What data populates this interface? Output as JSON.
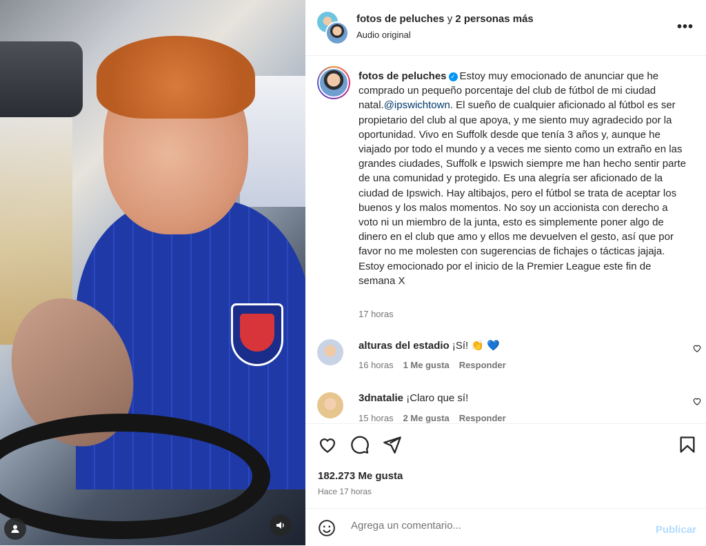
{
  "media": {
    "user_icon": "person-icon",
    "audio_icon": "speaker-icon"
  },
  "header": {
    "title_user": "fotos de peluches",
    "title_rest": " y ",
    "title_others": "2 personas más",
    "subtitle": "Audio original",
    "more_icon": "more-horizontal-icon",
    "more_label": "•••"
  },
  "caption": {
    "username": "fotos de peluches",
    "verified_icon": "verified-badge-icon",
    "verified_glyph": "✓",
    "text_part1": "Estoy muy emocionado de anunciar que he comprado un pequeño porcentaje del club de fútbol de mi ciudad natal.",
    "mention": "@ipswichtown",
    "text_part2": ". El sueño de cualquier aficionado al fútbol es ser propietario del club al que apoya, y me siento muy agradecido por la oportunidad. Vivo en Suffolk desde que tenía 3 años y, aunque he viajado por todo el mundo y a veces me siento como un extraño en las grandes ciudades, Suffolk e Ipswich siempre me han hecho sentir parte de una comunidad y protegido. Es una alegría ser aficionado de la ciudad de Ipswich. Hay altibajos, pero el fútbol se trata de aceptar los buenos y los malos momentos. No soy un accionista con derecho a voto ni un miembro de la junta, esto es simplemente poner algo de dinero en el club que amo y ellos me devuelven el gesto, así que por favor no me molesten con sugerencias de fichajes o tácticas jajaja. Estoy emocionado por el inicio de la Premier League este fin de semana X",
    "time": "17 horas"
  },
  "comments": [
    {
      "username": "alturas del estadio",
      "text": "¡Sí! 👏 💙",
      "time": "16 horas",
      "likes": "1 Me gusta",
      "reply": "Responder"
    },
    {
      "username": "3dnatalie",
      "text": "¡Claro que sí!",
      "time": "15 horas",
      "likes": "2 Me gusta",
      "reply": "Responder"
    }
  ],
  "actions": {
    "like_icon": "heart-icon",
    "comment_icon": "comment-bubble-icon",
    "share_icon": "paper-plane-icon",
    "save_icon": "bookmark-icon",
    "likes_count": "182.273 Me gusta",
    "posted_ago": "Hace 17 horas"
  },
  "add_comment": {
    "emoji_icon": "emoji-smile-icon",
    "placeholder": "Agrega un comentario...",
    "post_label": "Publicar"
  },
  "colors": {
    "accent_blue": "#0095f6",
    "post_disabled": "#b3dbff",
    "muted_text": "#737373"
  }
}
